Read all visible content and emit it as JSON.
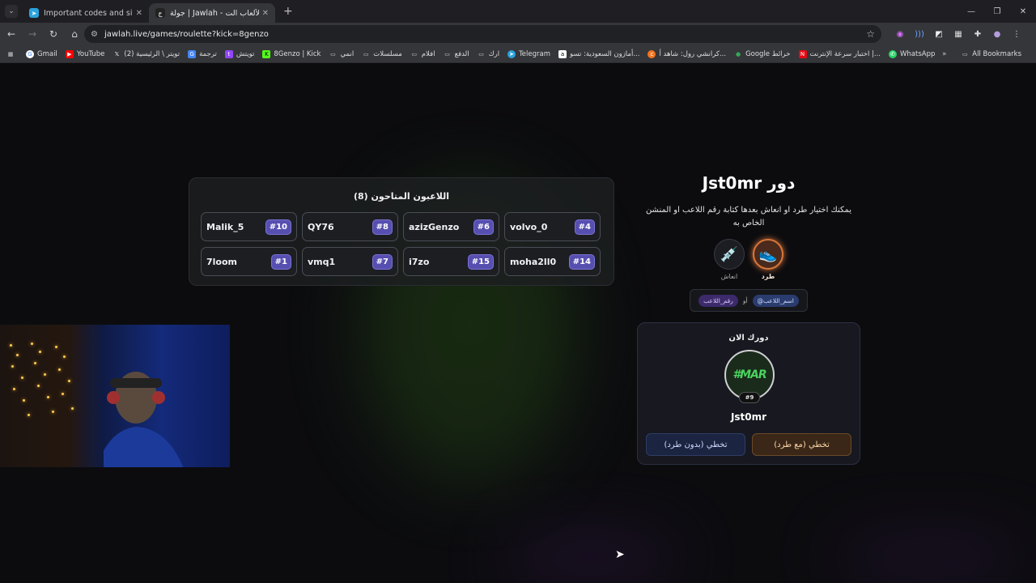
{
  "browser": {
    "tabs": [
      {
        "title": "Important codes and sites | قناة",
        "active": false
      },
      {
        "title": "جولة | Jawlah - منصة الألعاب الت",
        "active": true
      }
    ],
    "url": "jawlah.live/games/roulette?kick=8genzo",
    "bookmarks": [
      "Gmail",
      "YouTube",
      "(2) تويتر \\ الرئيسية",
      "ترجمة",
      "تويتش",
      "8Genzo | Kick",
      "انمي",
      "مسلسلات",
      "افلام",
      "الدفع",
      "ارك",
      "Telegram",
      "أمازون السعودية: تسو...",
      "كرانشي رول: شاهد أ...",
      "Google خرائط",
      "اختبار سرعة الإنترنت |...",
      "WhatsApp"
    ],
    "all_bookmarks": "All Bookmarks"
  },
  "players_panel": {
    "title": "اللاعبون المتاحون (8)",
    "players": [
      {
        "name": "volvo_0",
        "num": "#4"
      },
      {
        "name": "azizGenzo",
        "num": "#6"
      },
      {
        "name": "QY76",
        "num": "#8"
      },
      {
        "name": "Malik_5",
        "num": "#10"
      },
      {
        "name": "moha2ll0",
        "num": "#14"
      },
      {
        "name": "i7zo",
        "num": "#15"
      },
      {
        "name": "vmq1",
        "num": "#7"
      },
      {
        "name": "7loom",
        "num": "#1"
      }
    ]
  },
  "turn": {
    "title": "دور Jst0mr",
    "description": "يمكنك اختيار طرد او انعاش بعدها كتابة رقم اللاعب او المنشن الخاص به",
    "actions": {
      "kick": "طرد",
      "revive": "انعاش"
    },
    "hint": {
      "mention": "@اسم_اللاعب",
      "or": "أو",
      "number": "رقم_اللاعب"
    }
  },
  "current": {
    "label": "دورك الان",
    "logo": "#MAR",
    "number": "#9",
    "name": "Jst0mr",
    "skip_kick": "تخطي (مع طرد)",
    "skip_nokick": "تخطي (بدون طرد)"
  },
  "colors": {
    "accent_purple": "#574fb0",
    "kick_orange": "#6b4a2a",
    "nokick_blue": "#2f3d66"
  }
}
